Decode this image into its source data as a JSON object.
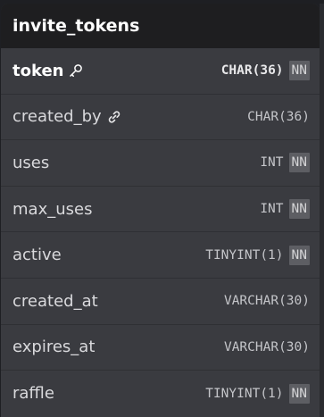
{
  "table": {
    "name": "invite_tokens",
    "columns": [
      {
        "name": "token",
        "type": "CHAR(36)",
        "nn": true,
        "pk": true,
        "icon": "key-icon",
        "nn_label": "NN"
      },
      {
        "name": "created_by",
        "type": "CHAR(36)",
        "nn": false,
        "pk": false,
        "icon": "link-icon",
        "nn_label": ""
      },
      {
        "name": "uses",
        "type": "INT",
        "nn": true,
        "pk": false,
        "icon": "",
        "nn_label": "NN"
      },
      {
        "name": "max_uses",
        "type": "INT",
        "nn": true,
        "pk": false,
        "icon": "",
        "nn_label": "NN"
      },
      {
        "name": "active",
        "type": "TINYINT(1)",
        "nn": true,
        "pk": false,
        "icon": "",
        "nn_label": "NN"
      },
      {
        "name": "created_at",
        "type": "VARCHAR(30)",
        "nn": false,
        "pk": false,
        "icon": "",
        "nn_label": ""
      },
      {
        "name": "expires_at",
        "type": "VARCHAR(30)",
        "nn": false,
        "pk": false,
        "icon": "",
        "nn_label": ""
      },
      {
        "name": "raffle",
        "type": "TINYINT(1)",
        "nn": true,
        "pk": false,
        "icon": "",
        "nn_label": "NN"
      }
    ]
  },
  "colors": {
    "header_bg": "#1e1e20",
    "body_bg": "#3a3b40",
    "nn_badge_bg": "#5d5e63"
  }
}
